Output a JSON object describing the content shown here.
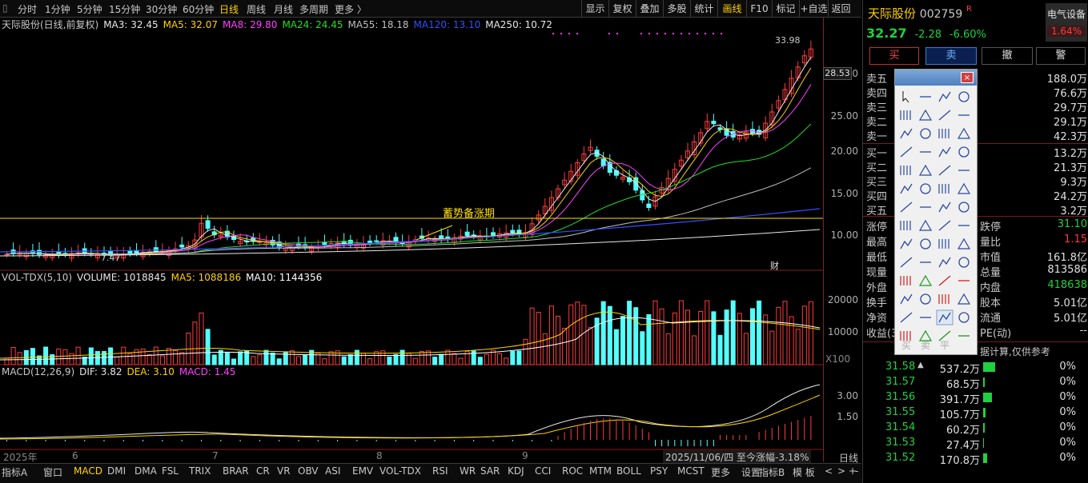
{
  "topbar": {
    "periods": [
      "分时",
      "1分钟",
      "5分钟",
      "15分钟",
      "30分钟",
      "60分钟",
      "日线",
      "周线",
      "月线",
      "多周期",
      "更多 〉"
    ],
    "active_period": "日线",
    "right_buttons": [
      "显示",
      "复权",
      "叠加",
      "多股",
      "统计",
      "画线",
      "F10",
      "标记",
      "+自选",
      "返回"
    ],
    "active_right": "画线"
  },
  "kline": {
    "legend_name": "天际股份(日线,前复权)",
    "ma": [
      {
        "label": "MA3: 32.45",
        "color": "#e8e8e8"
      },
      {
        "label": "MA5: 32.07",
        "color": "#ffd200"
      },
      {
        "label": "MA8: 29.80",
        "color": "#ff40ff"
      },
      {
        "label": "MA24: 24.45",
        "color": "#20e020"
      },
      {
        "label": "MA55: 18.18",
        "color": "#c0c0c0"
      },
      {
        "label": "MA120: 13.10",
        "color": "#3050ff"
      },
      {
        "label": "MA250: 10.72",
        "color": "#e8e8e8"
      }
    ],
    "high_label": "33.98",
    "low_label": "7.47",
    "price_tag": "28.53",
    "annotation": "蓄势备涨期",
    "event_mark": "财",
    "y_ticks": [
      "30.00",
      "25.00",
      "20.00",
      "15.00",
      "10.00"
    ]
  },
  "volume": {
    "legend": [
      {
        "label": "VOL-TDX(5,10)",
        "color": "#c8c8c8"
      },
      {
        "label": "VOLUME: 1018845",
        "color": "#e8e8e8"
      },
      {
        "label": "MA5: 1088186",
        "color": "#ffd200"
      },
      {
        "label": "MA10: 1144356",
        "color": "#ffffff"
      }
    ],
    "y_ticks": [
      "20000",
      "10000"
    ],
    "unit": "X100"
  },
  "macd": {
    "legend": [
      {
        "label": "MACD(12,26,9)",
        "color": "#c8c8c8"
      },
      {
        "label": "DIF: 3.82",
        "color": "#e8e8e8"
      },
      {
        "label": "DEA: 3.10",
        "color": "#ffd200"
      },
      {
        "label": "MACD: 1.45",
        "color": "#ff40ff"
      }
    ],
    "y_ticks": [
      "3.00",
      "1.50"
    ]
  },
  "xaxis": {
    "labels": [
      "2025年",
      "6",
      "7",
      "8",
      "9"
    ],
    "date_tip": "2025/11/06/四  至今涨幅-3.18%",
    "period": "日线"
  },
  "indicator_tabs": [
    "指标A",
    "窗口",
    "MACD",
    "DMI",
    "DMA",
    "FSL",
    "TRIX",
    "BRAR",
    "CR",
    "VR",
    "OBV",
    "ASI",
    "EMV",
    "VOL-TDX",
    "RSI",
    "WR",
    "SAR",
    "KDJ",
    "CCI",
    "ROC",
    "MTM",
    "BOLL",
    "PSY",
    "MCST",
    "更多",
    "设置"
  ],
  "active_tab": "MACD",
  "bottom_right": [
    "指标B",
    "模 板",
    "<",
    ">",
    "+",
    "-"
  ],
  "quote": {
    "name": "天际股份",
    "code": "002759",
    "flag": "R",
    "price": "32.27",
    "change": "-2.28",
    "pct": "-6.60%",
    "sector": "电气设备",
    "sector_pct": "1.64%",
    "buttons": [
      "买",
      "卖",
      "撤",
      "警"
    ]
  },
  "orderbook": {
    "sell": [
      {
        "label": "卖五",
        "value": "188.0万"
      },
      {
        "label": "卖四",
        "value": "76.6万"
      },
      {
        "label": "卖三",
        "value": "29.7万"
      },
      {
        "label": "卖二",
        "value": "29.1万"
      },
      {
        "label": "卖一",
        "value": "42.3万"
      }
    ],
    "buy": [
      {
        "label": "买一",
        "value": "13.2万"
      },
      {
        "label": "买二",
        "value": "21.3万"
      },
      {
        "label": "买三",
        "value": "9.3万"
      },
      {
        "label": "买四",
        "value": "24.2万"
      },
      {
        "label": "买五",
        "value": "3.2万"
      }
    ]
  },
  "stats": [
    {
      "l": "涨停",
      "r_label": "跌停",
      "r_value": "31.10"
    },
    {
      "l": "最高",
      "r_label": "量比",
      "r_value": "1.15"
    },
    {
      "l": "最低",
      "r_label": "市值",
      "r_value": "161.8亿"
    },
    {
      "l": "现量",
      "r_label": "总量",
      "r_value": "813586"
    },
    {
      "l": "外盘",
      "r_label": "内盘",
      "r_value": "418638"
    },
    {
      "l": "换手",
      "r_label": "股本",
      "r_value": "5.01亿"
    },
    {
      "l": "净资",
      "r_label": "流通",
      "r_value": "5.01亿"
    },
    {
      "l": "收益(3",
      "r_label": "PE(动)",
      "r_value": "--"
    }
  ],
  "depth_note": "据计算,仅供参考",
  "depth": [
    {
      "price": "31.58",
      "flag": "▲",
      "amount": "537.2万",
      "pct": "0%",
      "bar": 38
    },
    {
      "price": "31.57",
      "flag": "",
      "amount": "68.5万",
      "pct": "0%",
      "bar": 5
    },
    {
      "price": "31.56",
      "flag": "",
      "amount": "391.7万",
      "pct": "0%",
      "bar": 28
    },
    {
      "price": "31.55",
      "flag": "",
      "amount": "105.7万",
      "pct": "0%",
      "bar": 8
    },
    {
      "price": "31.54",
      "flag": "",
      "amount": "60.2万",
      "pct": "0%",
      "bar": 4
    },
    {
      "price": "31.53",
      "flag": "",
      "amount": "27.4万",
      "pct": "0%",
      "bar": 2
    },
    {
      "price": "31.52",
      "flag": "",
      "amount": "170.8万",
      "pct": "0%",
      "bar": 12
    }
  ],
  "drawing_toolbox": {
    "bottom_labels": [
      "买",
      "卖",
      "平"
    ]
  }
}
